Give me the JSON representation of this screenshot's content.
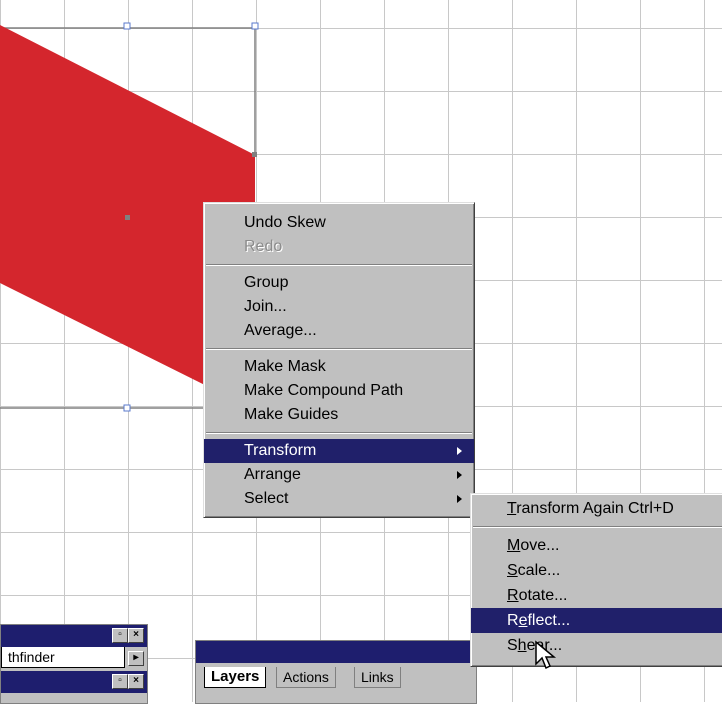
{
  "canvas": {
    "grid_color": "#c8c8c8",
    "shape_color": "#d4262d",
    "panel_title_color": "#1e1e6e"
  },
  "context_menu": {
    "items": [
      {
        "label": "Undo Skew"
      },
      {
        "label": "Redo"
      },
      {
        "label": "Group"
      },
      {
        "label": "Join..."
      },
      {
        "label": "Average..."
      },
      {
        "label": "Make Mask"
      },
      {
        "label": "Make Compound Path"
      },
      {
        "label": "Make Guides"
      },
      {
        "label": "Transform"
      },
      {
        "label": "Arrange"
      },
      {
        "label": "Select"
      }
    ]
  },
  "transform_submenu": {
    "items": [
      {
        "label": "Transform Again",
        "mnemonic": "T",
        "rest": "ransform Again",
        "shortcut": "Ctrl+D"
      },
      {
        "label": "Move...",
        "mnemonic": "M",
        "rest": "ove..."
      },
      {
        "label": "Scale...",
        "mnemonic": "S",
        "rest": "cale..."
      },
      {
        "label": "Rotate...",
        "mnemonic": "R",
        "rest": "otate..."
      },
      {
        "label": "Reflect...",
        "pre": "R",
        "mnemonic": "e",
        "rest": "flect..."
      },
      {
        "label": "Shear...",
        "pre": "S",
        "mnemonic": "h",
        "rest": "ear..."
      }
    ]
  },
  "pathfinder_palette": {
    "tab_label": "thfinder"
  },
  "layers_palette": {
    "tabs": [
      "Layers",
      "Actions",
      "Links"
    ]
  }
}
